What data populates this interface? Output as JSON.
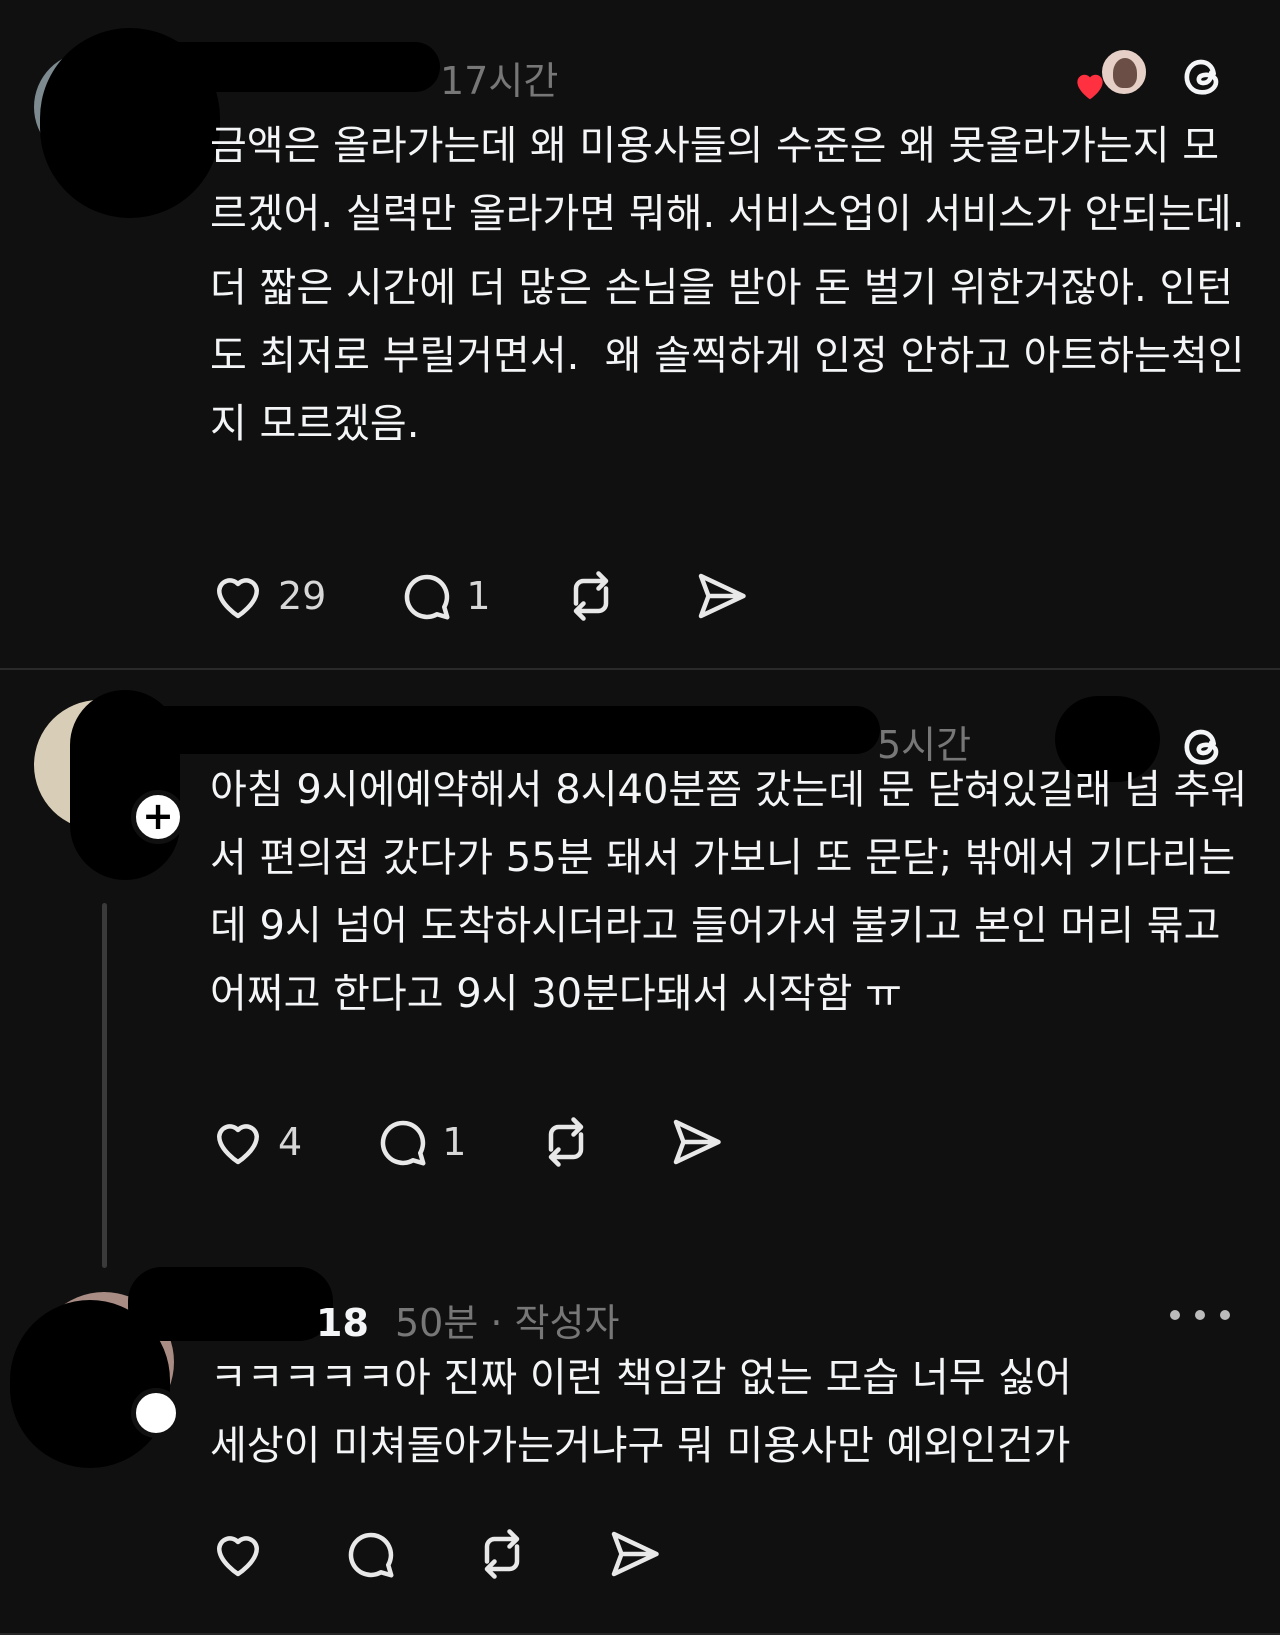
{
  "post1": {
    "time": "17시간",
    "paragraphs": [
      "금액은 올라가는데 왜 미용사들의 수준은 왜 못올라가는지 모르겠어. 실력만 올라가면 뭐해. 서비스업이 서비스가 안되는데.",
      "더 짧은 시간에 더 많은 손님을 받아 돈 벌기 위한거잖아. 인턴도 최저로 부릴거면서.  왜 솔찍하게 인정 안하고 아트하는척인지 모르겠음."
    ],
    "likes": "29",
    "replies": "1"
  },
  "post2": {
    "time": "5시간",
    "paragraphs": [
      "아침 9시에예약해서 8시40분쯤 갔는데 문 닫혀있길래 넘 추워서 편의점 갔다가 55분 돼서 가보니 또 문닫; 밖에서 기다리는데 9시 넘어 도착하시더라고 들어가서 불키고 본인 머리 묶고 어쩌고 한다고 9시 30분다돼서 시작함 ㅠ"
    ],
    "likes": "4",
    "replies": "1",
    "plus": "+"
  },
  "post3": {
    "author_suffix": "18",
    "time": "50분",
    "badge": " · 작성자",
    "paragraphs": [
      "ㅋㅋㅋㅋㅋ아 진짜 이런 책임감 없는 모습 너무 싫어",
      "세상이 미쳐돌아가는거냐구 뭐 미용사만 예외인건가"
    ]
  },
  "icons": {
    "like": "heart-icon",
    "reply": "comment-bubble-icon",
    "repost": "repost-icon",
    "share": "send-icon",
    "app": "threads-logo-icon"
  },
  "colors": {
    "background": "#101010",
    "text": "#f3f5f7",
    "muted": "#777777",
    "liked": "#ff3040"
  }
}
